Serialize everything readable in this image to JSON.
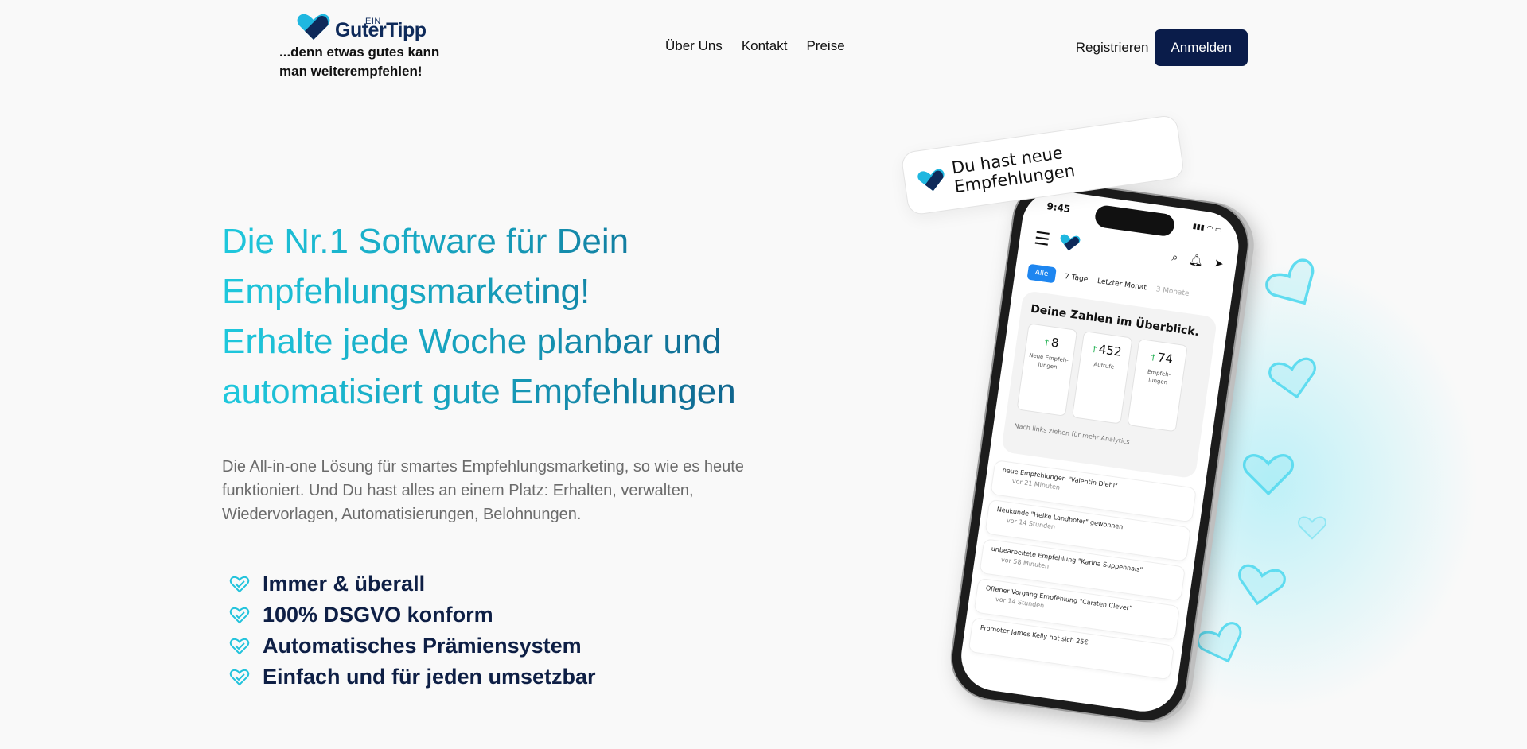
{
  "header": {
    "logo_ein": "EIN",
    "logo_name": "GuterTipp",
    "tagline": "...denn etwas gutes kann man weiterempfehlen!",
    "nav": [
      "Über Uns",
      "Kontakt",
      "Preise"
    ],
    "register_label": "Registrieren",
    "login_label": "Anmelden"
  },
  "hero": {
    "headline_1": "Die Nr.1 Software für Dein",
    "headline_2": "Empfehlungsmarketing!",
    "headline_3": "Erhalte jede Woche planbar und",
    "headline_4": "automatisiert gute Empfehlungen",
    "subtext": "Die All-in-one Lösung für smartes Empfehlungsmarketing, so wie es heute funktioniert. Und Du hast alles an einem Platz: Erhalten, verwalten, Wiedervorlagen, Automatisierungen, Belohnungen.",
    "features": [
      "Immer & überall",
      "100% DSGVO konform",
      "Automatisches Prämiensystem",
      "Einfach und für jeden umsetzbar"
    ]
  },
  "notification": {
    "text": "Du hast neue Empfehlungen"
  },
  "phone": {
    "time": "9:45",
    "tabs": [
      "Alle",
      "7 Tage",
      "Letzter Monat",
      "3 Monate"
    ],
    "card_title": "Deine Zahlen im Überblick.",
    "stats": [
      {
        "value": "8",
        "label": "Neue Empfeh-lungen"
      },
      {
        "value": "452",
        "label": "Aufrufe"
      },
      {
        "value": "74",
        "label": "Empfeh-lungen"
      }
    ],
    "hint": "Nach links ziehen für mehr Analytics",
    "feed": [
      {
        "title": "neue Empfehlungen \"Valentin Diehl\"",
        "time": "vor 21 Minuten"
      },
      {
        "title": "Neukunde \"Heike Landhofer\" gewonnen",
        "time": "vor 14 Stunden"
      },
      {
        "title": "unbearbeitete Empfehlung \"Karina Suppenhals\"",
        "time": "vor 58 Minuten"
      },
      {
        "title": "Offener Vorgang Empfehlung \"Carsten Clever\"",
        "time": "vor 14 Stunden"
      },
      {
        "title": "Promoter James Kelly hat sich 25€",
        "time": ""
      }
    ]
  },
  "colors": {
    "navy": "#0a1c4a",
    "accent": "#1ec8dd",
    "gradient_end": "#0c4f7c"
  }
}
